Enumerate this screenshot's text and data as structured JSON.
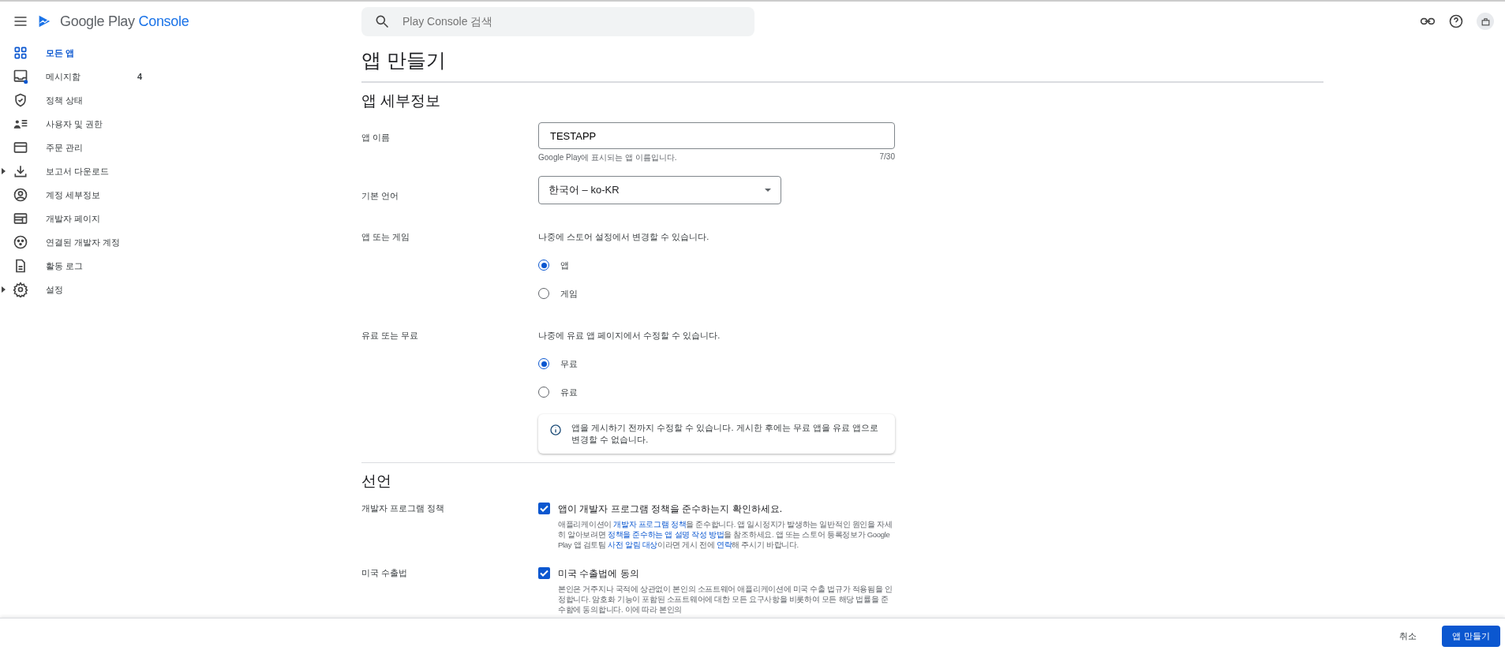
{
  "header": {
    "brand": "Google Play",
    "brand_suffix": "Console",
    "search": {
      "placeholder": "Play Console 검색"
    }
  },
  "sidebar": {
    "items": [
      {
        "label": "모든 앱",
        "selected": true,
        "expandable": false
      },
      {
        "label": "메시지함",
        "selected": false,
        "expandable": false,
        "badge": "4"
      },
      {
        "label": "정책 상태",
        "selected": false,
        "expandable": false
      },
      {
        "label": "사용자 및 권한",
        "selected": false,
        "expandable": false
      },
      {
        "label": "주문 관리",
        "selected": false,
        "expandable": false
      },
      {
        "label": "보고서 다운로드",
        "selected": false,
        "expandable": true
      },
      {
        "label": "계정 세부정보",
        "selected": false,
        "expandable": false
      },
      {
        "label": "개발자 페이지",
        "selected": false,
        "expandable": false
      },
      {
        "label": "연결된 개발자 계정",
        "selected": false,
        "expandable": false
      },
      {
        "label": "활동 로그",
        "selected": false,
        "expandable": false
      },
      {
        "label": "설정",
        "selected": false,
        "expandable": true
      }
    ]
  },
  "page": {
    "title": "앱 만들기",
    "details": {
      "heading": "앱 세부정보",
      "app_name": {
        "label": "앱 이름",
        "value": "TESTAPP",
        "helper": "Google Play에 표시되는 앱 이름입니다.",
        "count": "7/30"
      },
      "language": {
        "label": "기본 언어",
        "value": "한국어 – ko-KR"
      },
      "radio_groups": [
        {
          "label": "앱 또는 게임",
          "hint": "나중에 스토어 설정에서 변경할 수 있습니다.",
          "options": [
            {
              "label": "앱",
              "selected": true
            },
            {
              "label": "게임",
              "selected": false
            }
          ]
        },
        {
          "label": "유료 또는 무료",
          "hint": "나중에 유료 앱 페이지에서 수정할 수 있습니다.",
          "options": [
            {
              "label": "무료",
              "selected": true
            },
            {
              "label": "유료",
              "selected": false
            }
          ],
          "info": "앱을 게시하기 전까지 수정할 수 있습니다. 게시한 후에는 무료 앱을 유료 앱으로 변경할 수 없습니다."
        }
      ]
    },
    "declarations": {
      "heading": "선언",
      "items": [
        {
          "label": "개발자 프로그램 정책",
          "checked": true,
          "title": "앱이 개발자 프로그램 정책을 준수하는지 확인하세요.",
          "text": [
            {
              "text": "애플리케이션이 ",
              "link": false
            },
            {
              "text": "개발자 프로그램 정책",
              "link": true
            },
            {
              "text": "을 준수합니다. 앱 일시정지가 발생하는 일반적인 원인을 자세히 알아보려면 ",
              "link": false
            },
            {
              "text": "정책을 준수하는 앱 설명 작성 방법",
              "link": true
            },
            {
              "text": "을 참조하세요. 앱 또는 스토어 등록정보가 Google Play 앱 검토팀 ",
              "link": false
            },
            {
              "text": "사전 알림 대상",
              "link": true
            },
            {
              "text": "이라면 게시 전에 ",
              "link": false
            },
            {
              "text": "연락",
              "link": true
            },
            {
              "text": "해 주시기 바랍니다.",
              "link": false
            }
          ]
        },
        {
          "label": "미국 수출법",
          "checked": true,
          "title": "미국 수출법에 동의",
          "text": [
            {
              "text": "본인은 거주지나 국적에 상관없이 본인의 소프트웨어 애플리케이션에 미국 수출 법규가 적용됨을 인정합니다. 암호화 기능이 포함된 소프트웨어에 대한 모든 요구사항을 비롯하여 모든 해당 법률을 준수함에 동의합니다. 이에 따라 본인의",
              "link": false
            }
          ]
        }
      ]
    }
  },
  "footer": {
    "cancel": "취소",
    "submit": "앱 만들기"
  }
}
